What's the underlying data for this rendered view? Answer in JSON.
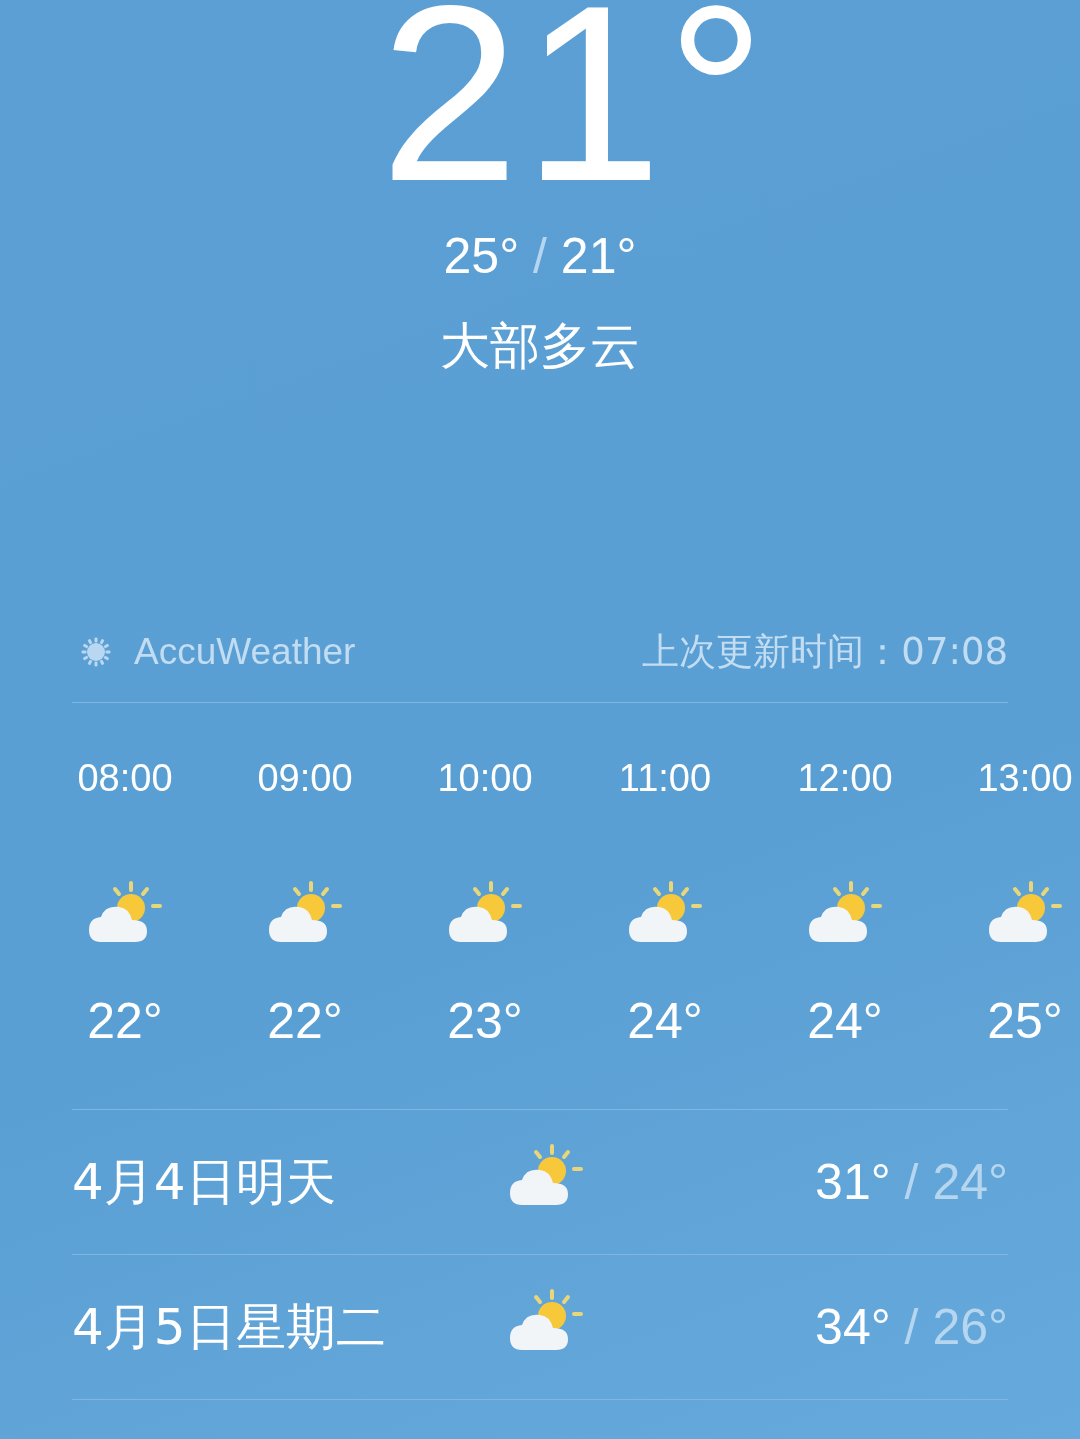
{
  "current": {
    "temperature": "21°",
    "high": "25°",
    "separator": "/",
    "low": "21°",
    "condition": "大部多云"
  },
  "source": {
    "name": "AccuWeather",
    "updated_label": "上次更新时间：",
    "updated_time": "07:08"
  },
  "hourly": [
    {
      "time": "08:00",
      "kind": "partly-cloudy",
      "temp": "22°"
    },
    {
      "time": "09:00",
      "kind": "partly-cloudy",
      "temp": "22°"
    },
    {
      "time": "10:00",
      "kind": "partly-cloudy",
      "temp": "23°"
    },
    {
      "time": "11:00",
      "kind": "partly-cloudy",
      "temp": "24°"
    },
    {
      "time": "12:00",
      "kind": "partly-cloudy",
      "temp": "24°"
    },
    {
      "time": "13:00",
      "kind": "partly-cloudy",
      "temp": "25°"
    }
  ],
  "daily": [
    {
      "day": "4月4日明天",
      "kind": "partly-cloudy",
      "high": "31°",
      "separator": "/",
      "low": "24°"
    },
    {
      "day": "4月5日星期二",
      "kind": "partly-cloudy",
      "high": "34°",
      "separator": "/",
      "low": "26°"
    }
  ]
}
